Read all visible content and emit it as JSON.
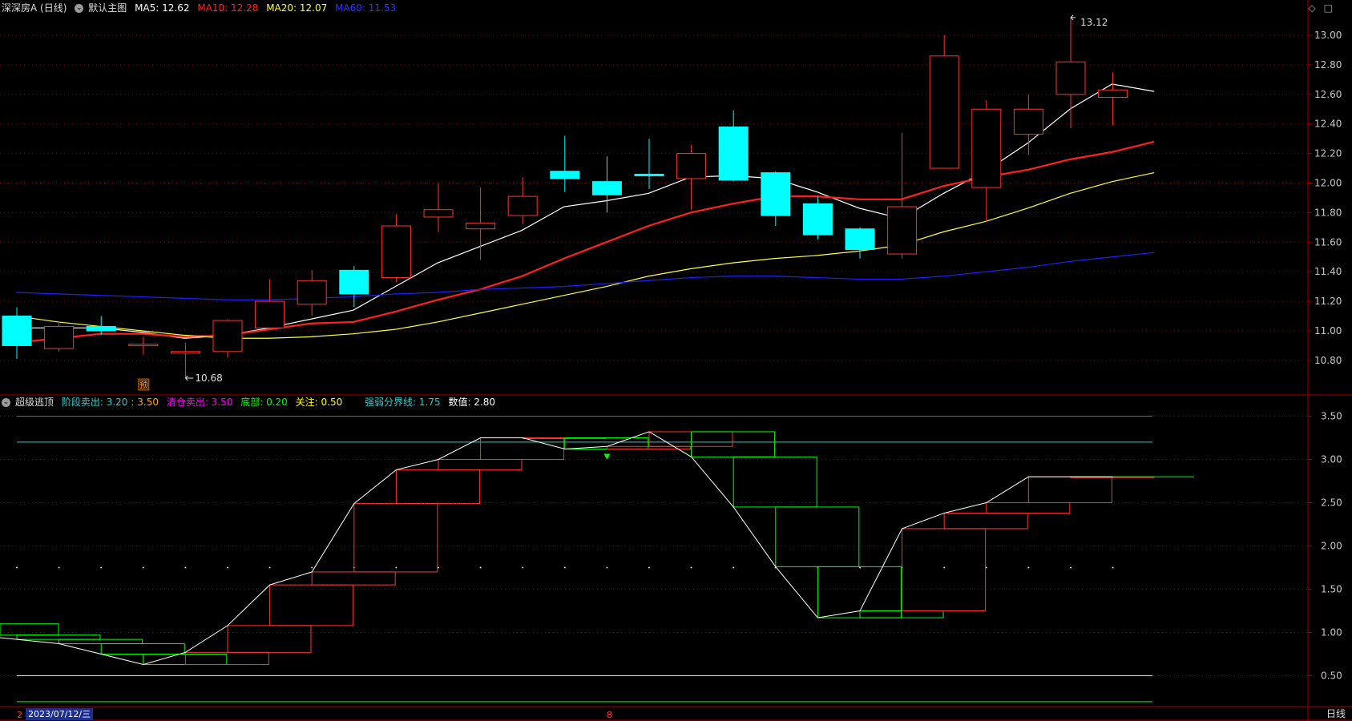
{
  "main_panel": {
    "title": "深深房A (日线)",
    "template": "默认主图",
    "ma5": "MA5: 12.62",
    "ma10": "MA10: 12.28",
    "ma20": "MA20: 12.07",
    "ma60": "MA60: 11.53",
    "high_label": "13.12",
    "low_label": "10.68",
    "marker_label": "预"
  },
  "sub_panel": {
    "title": "超级逃顶",
    "stage_sell": "阶段卖出: 3.20",
    "stage_sell_2": ": 3.50",
    "clear_sell": "清仓卖出: 3.50",
    "bottom": "底部: 0.20",
    "watch": "关注: 0.50",
    "divide": "强弱分界线: 1.75",
    "value": "数值: 2.80"
  },
  "footer": {
    "date": "2023/07/12/三",
    "period": "日线",
    "left_digit": "2",
    "mid_digit": "8"
  },
  "icons": [
    "diamond-icon",
    "square-icon",
    "collapse-circle-icon"
  ],
  "colors": {
    "up": "#ff3232",
    "down": "#00ffff",
    "ma5": "#ffffff",
    "ma10": "#ff2020",
    "ma20": "#ffff40",
    "ma60": "#2020ff",
    "grid": "#8b0000",
    "magenta": "#ff00ff",
    "cyan": "#33cccc",
    "green": "#00ff00",
    "yellow": "#ffff00"
  },
  "chart_data": [
    {
      "type": "candlestick",
      "title": "深深房A (日线)",
      "ylim": [
        10.6,
        13.1
      ],
      "yticks": [
        "10.80",
        "11.00",
        "11.20",
        "11.40",
        "11.60",
        "11.80",
        "12.00",
        "12.20",
        "12.40",
        "12.60",
        "12.80",
        "13.00"
      ],
      "candles": [
        {
          "o": 11.1,
          "c": 10.9,
          "h": 11.16,
          "l": 10.81
        },
        {
          "o": 10.88,
          "c": 11.03,
          "h": 11.06,
          "l": 10.86
        },
        {
          "o": 11.03,
          "c": 11.0,
          "h": 11.1,
          "l": 10.97
        },
        {
          "o": 10.9,
          "c": 10.91,
          "h": 10.96,
          "l": 10.84
        },
        {
          "o": 10.85,
          "c": 10.86,
          "h": 10.92,
          "l": 10.68
        },
        {
          "o": 10.86,
          "c": 11.07,
          "h": 11.08,
          "l": 10.82
        },
        {
          "o": 11.02,
          "c": 11.2,
          "h": 11.35,
          "l": 11.01
        },
        {
          "o": 11.18,
          "c": 11.34,
          "h": 11.41,
          "l": 11.1
        },
        {
          "o": 11.41,
          "c": 11.25,
          "h": 11.44,
          "l": 11.16
        },
        {
          "o": 11.36,
          "c": 11.71,
          "h": 11.79,
          "l": 11.33
        },
        {
          "o": 11.77,
          "c": 11.82,
          "h": 12.0,
          "l": 11.67
        },
        {
          "o": 11.69,
          "c": 11.73,
          "h": 11.97,
          "l": 11.48
        },
        {
          "o": 11.78,
          "c": 11.91,
          "h": 12.04,
          "l": 11.72
        },
        {
          "o": 12.08,
          "c": 12.03,
          "h": 12.32,
          "l": 11.94
        },
        {
          "o": 12.01,
          "c": 11.92,
          "h": 12.18,
          "l": 11.8
        },
        {
          "o": 12.06,
          "c": 12.05,
          "h": 12.3,
          "l": 11.96
        },
        {
          "o": 12.03,
          "c": 12.2,
          "h": 12.26,
          "l": 11.82
        },
        {
          "o": 12.38,
          "c": 12.02,
          "h": 12.49,
          "l": 12.01
        },
        {
          "o": 12.07,
          "c": 11.78,
          "h": 12.08,
          "l": 11.71
        },
        {
          "o": 11.86,
          "c": 11.65,
          "h": 11.91,
          "l": 11.62
        },
        {
          "o": 11.69,
          "c": 11.55,
          "h": 11.7,
          "l": 11.49
        },
        {
          "o": 11.52,
          "c": 11.84,
          "h": 12.34,
          "l": 11.49
        },
        {
          "o": 12.1,
          "c": 12.86,
          "h": 13.0,
          "l": 12.1
        },
        {
          "o": 11.97,
          "c": 12.5,
          "h": 12.56,
          "l": 11.74
        },
        {
          "o": 12.33,
          "c": 12.5,
          "h": 12.6,
          "l": 12.19
        },
        {
          "o": 12.6,
          "c": 12.82,
          "h": 13.12,
          "l": 12.37
        },
        {
          "o": 12.58,
          "c": 12.63,
          "h": 12.75,
          "l": 12.39
        }
      ],
      "series": [
        {
          "name": "MA5",
          "values": [
            11.02,
            11.02,
            11.02,
            10.99,
            10.95,
            10.97,
            11.02,
            11.08,
            11.14,
            11.3,
            11.46,
            11.57,
            11.68,
            11.84,
            11.88,
            11.93,
            12.04,
            12.05,
            12.03,
            11.94,
            11.83,
            11.76,
            11.93,
            12.08,
            12.27,
            12.5,
            12.67,
            12.62
          ]
        },
        {
          "name": "MA10",
          "values": [
            10.92,
            10.95,
            10.98,
            10.98,
            10.96,
            10.97,
            11.01,
            11.05,
            11.06,
            11.13,
            11.21,
            11.28,
            11.37,
            11.49,
            11.6,
            11.71,
            11.8,
            11.86,
            11.91,
            11.91,
            11.89,
            11.89,
            11.98,
            12.04,
            12.09,
            12.16,
            12.21,
            12.28
          ]
        },
        {
          "name": "MA20",
          "values": [
            11.1,
            11.06,
            11.03,
            11.0,
            10.97,
            10.95,
            10.95,
            10.96,
            10.98,
            11.01,
            11.06,
            11.12,
            11.18,
            11.24,
            11.3,
            11.37,
            11.42,
            11.46,
            11.49,
            11.51,
            11.54,
            11.58,
            11.67,
            11.74,
            11.83,
            11.93,
            12.01,
            12.07
          ]
        },
        {
          "name": "MA60",
          "values": [
            11.26,
            11.25,
            11.24,
            11.23,
            11.22,
            11.21,
            11.21,
            11.22,
            11.23,
            11.25,
            11.26,
            11.28,
            11.29,
            11.3,
            11.32,
            11.34,
            11.36,
            11.37,
            11.37,
            11.36,
            11.35,
            11.35,
            11.37,
            11.4,
            11.43,
            11.47,
            11.5,
            11.53
          ]
        }
      ]
    },
    {
      "type": "indicator",
      "title": "超级逃顶",
      "ylim": [
        0.2,
        3.6
      ],
      "yticks": [
        "0.50",
        "1.00",
        "1.50",
        "2.00",
        "2.50",
        "3.00",
        "3.50"
      ],
      "levels": {
        "clear_sell": 3.5,
        "stage_sell": 3.2,
        "watch": 0.5,
        "bottom": 0.2,
        "divide": 1.75
      },
      "value": [
        0.97,
        0.92,
        0.87,
        0.75,
        0.63,
        0.77,
        1.08,
        1.55,
        1.7,
        2.49,
        2.88,
        3.0,
        3.25,
        3.25,
        3.12,
        3.15,
        3.32,
        3.03,
        2.45,
        1.76,
        1.17,
        1.25,
        2.2,
        2.38,
        2.5,
        2.8,
        2.8,
        2.8
      ],
      "bars": [
        {
          "open": 1.1,
          "close": 0.97,
          "color": "green"
        },
        {
          "open": 0.97,
          "close": 0.92,
          "color": "green"
        },
        {
          "open": 0.92,
          "close": 0.87,
          "color": "green"
        },
        {
          "open": 0.87,
          "close": 0.75,
          "color": "green"
        },
        {
          "open": 0.75,
          "close": 0.63,
          "color": "green"
        },
        {
          "open": 0.63,
          "close": 0.77,
          "color": "red"
        },
        {
          "open": 0.77,
          "close": 1.08,
          "color": "red"
        },
        {
          "open": 1.08,
          "close": 1.55,
          "color": "red"
        },
        {
          "open": 1.55,
          "close": 1.7,
          "color": "red"
        },
        {
          "open": 1.7,
          "close": 2.49,
          "color": "red"
        },
        {
          "open": 2.49,
          "close": 2.88,
          "color": "red"
        },
        {
          "open": 2.88,
          "close": 3.0,
          "color": "red"
        },
        {
          "open": 3.0,
          "close": 3.25,
          "color": "red"
        },
        {
          "open": 3.25,
          "close": 3.25,
          "color": "red"
        },
        {
          "open": 3.25,
          "close": 3.12,
          "color": "green"
        },
        {
          "open": 3.12,
          "close": 3.15,
          "color": "red"
        },
        {
          "open": 3.15,
          "close": 3.32,
          "color": "red"
        },
        {
          "open": 3.32,
          "close": 3.03,
          "color": "green"
        },
        {
          "open": 3.03,
          "close": 2.45,
          "color": "green"
        },
        {
          "open": 2.45,
          "close": 1.76,
          "color": "green"
        },
        {
          "open": 1.76,
          "close": 1.17,
          "color": "green"
        },
        {
          "open": 1.17,
          "close": 1.25,
          "color": "green"
        },
        {
          "open": 1.25,
          "close": 2.2,
          "color": "red"
        },
        {
          "open": 2.2,
          "close": 2.38,
          "color": "red"
        },
        {
          "open": 2.38,
          "close": 2.5,
          "color": "red"
        },
        {
          "open": 2.5,
          "close": 2.8,
          "color": "red"
        },
        {
          "open": 2.8,
          "close": 2.8,
          "color": "red"
        }
      ]
    }
  ]
}
